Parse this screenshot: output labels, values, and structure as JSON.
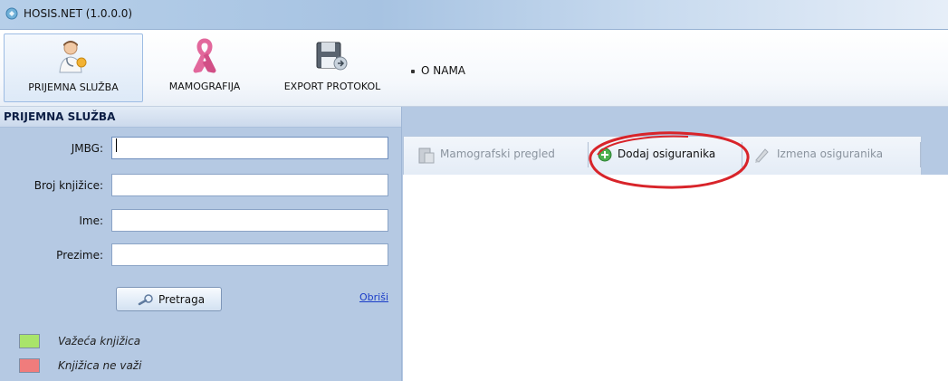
{
  "window": {
    "title": "HOSIS.NET (1.0.0.0)"
  },
  "ribbon": {
    "items": [
      {
        "label": "PRIJEMNA SLUŽBA",
        "icon": "doctor-icon",
        "selected": true
      },
      {
        "label": "MAMOGRAFIJA",
        "icon": "pink-ribbon-icon",
        "selected": false
      },
      {
        "label": "EXPORT PROTOKOL",
        "icon": "export-disk-icon",
        "selected": false
      }
    ],
    "menu_label": "O NAMA"
  },
  "panel": {
    "title": "PRIJEMNA SLUŽBA",
    "fields": [
      {
        "label": "JMBG:",
        "value": ""
      },
      {
        "label": "Broj knjižice:",
        "value": ""
      },
      {
        "label": "Ime:",
        "value": ""
      },
      {
        "label": "Prezime:",
        "value": ""
      }
    ],
    "search_button": "Pretraga",
    "clear_link": "Obriši",
    "legend": [
      {
        "label": "Važeća knjižica",
        "color": "#a9e46a"
      },
      {
        "label": "Knjižica ne važi",
        "color": "#f07c7c"
      }
    ]
  },
  "toolbar": {
    "items": [
      {
        "label": "Mamografski pregled",
        "enabled": false,
        "icon": "mammography-icon"
      },
      {
        "label": "Dodaj osiguranika",
        "enabled": true,
        "icon": "add-circle-icon",
        "highlighted": true
      },
      {
        "label": "Izmena osiguranika",
        "enabled": false,
        "icon": "pencil-icon"
      }
    ]
  },
  "colors": {
    "panel_bg": "#b5c9e3",
    "highlight_circle": "#d8242a",
    "link": "#1a3cc8"
  }
}
